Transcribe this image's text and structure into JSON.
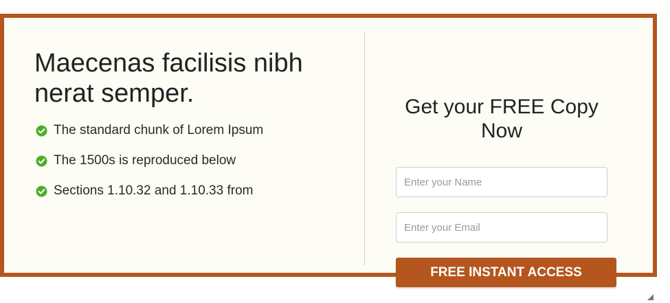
{
  "colors": {
    "accent": "#b5561f",
    "panel_background": "#fdfcf5",
    "check": "#4caf2a"
  },
  "left": {
    "headline": "Maecenas facilisis nibh nerat semper.",
    "features": [
      {
        "icon": "check-circle-icon",
        "label": "The standard chunk of Lorem Ipsum"
      },
      {
        "icon": "check-circle-icon",
        "label": "The 1500s is reproduced below"
      },
      {
        "icon": "check-circle-icon",
        "label": "Sections 1.10.32 and 1.10.33 from"
      }
    ]
  },
  "form": {
    "title": "Get your FREE Copy Now",
    "name_placeholder": "Enter your Name",
    "name_value": "",
    "email_placeholder": "Enter your Email",
    "email_value": "",
    "submit_label": "FREE INSTANT ACCESS"
  }
}
